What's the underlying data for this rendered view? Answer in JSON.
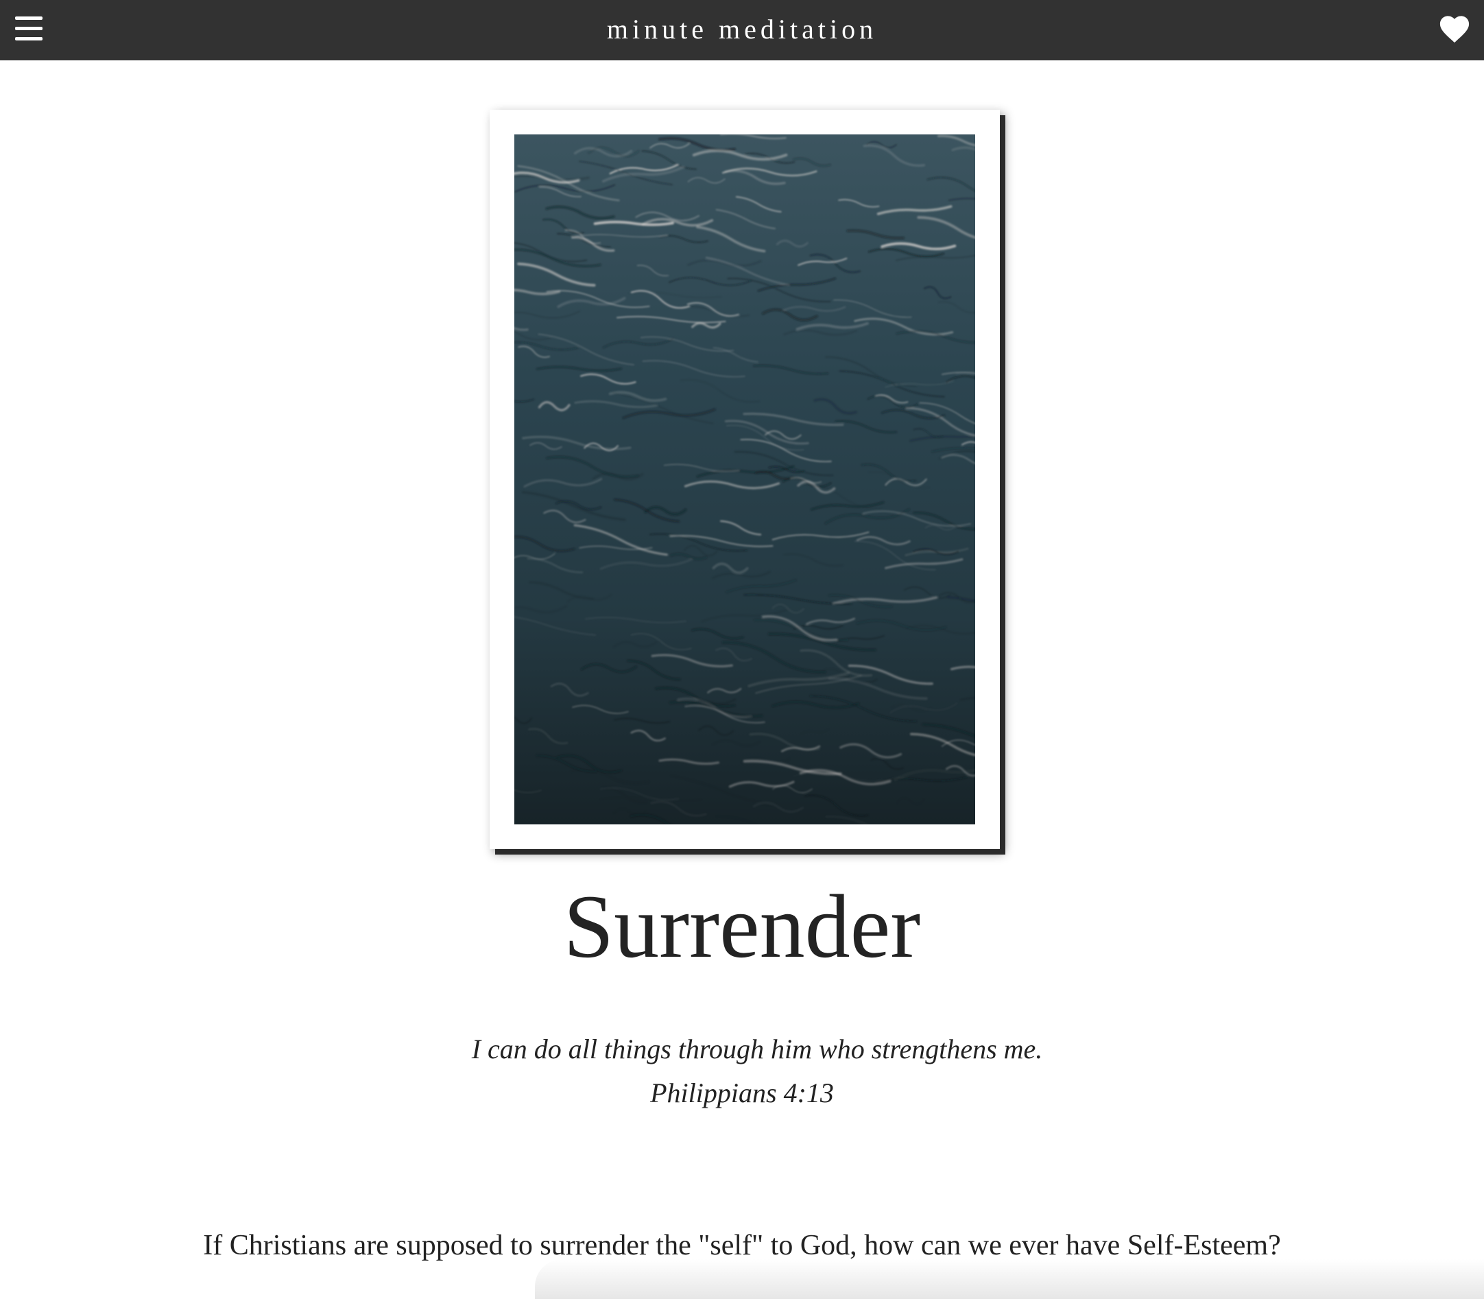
{
  "header": {
    "title": "minute meditation",
    "menu_icon": "hamburger-menu-icon",
    "favorite_icon": "heart-icon"
  },
  "hero": {
    "image_subject": "dark rippling ocean water"
  },
  "meditation": {
    "title": "Surrender",
    "verse_text": "I can do all things through him who strengthens me.",
    "verse_ref": "Philippians 4:13",
    "intro": "If Christians are supposed to surrender the \"self\" to God, how can we ever have Self-Esteem?"
  },
  "colors": {
    "header_bg": "#323232",
    "header_text": "#ffffff",
    "body_text": "#222222",
    "page_bg": "#ffffff"
  }
}
